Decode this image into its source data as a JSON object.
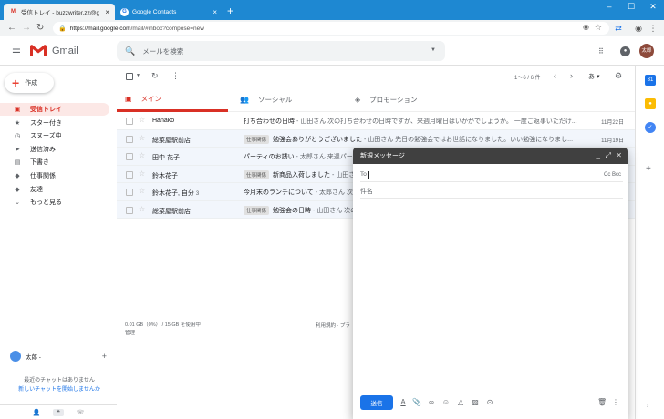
{
  "browser": {
    "tabs": [
      {
        "title": "受信トレイ - buzzwriter.zz@gmail.com",
        "favicon": "M",
        "active": true
      },
      {
        "title": "Google Contacts",
        "favicon": "G",
        "active": false
      }
    ],
    "url_host": "https://mail.google.com",
    "url_path": "/mail/#inbox?compose=new",
    "colors": {
      "tabbar": "#1e88d2"
    }
  },
  "gmail": {
    "logo_text": "Gmail",
    "search_placeholder": "メールを検索",
    "avatar_text": "太郎"
  },
  "sidebar": {
    "compose_label": "作成",
    "items": [
      {
        "label": "受信トレイ",
        "icon": "inbox-icon",
        "glyph": "▣",
        "active": true
      },
      {
        "label": "スター付き",
        "icon": "star-icon",
        "glyph": "★",
        "active": false
      },
      {
        "label": "スヌーズ中",
        "icon": "clock-icon",
        "glyph": "◷",
        "active": false
      },
      {
        "label": "送信済み",
        "icon": "send-icon",
        "glyph": "➤",
        "active": false
      },
      {
        "label": "下書き",
        "icon": "draft-icon",
        "glyph": "▤",
        "active": false
      },
      {
        "label": "仕事関係",
        "icon": "label-icon",
        "glyph": "◆",
        "active": false
      },
      {
        "label": "友達",
        "icon": "label-icon",
        "glyph": "◆",
        "active": false
      },
      {
        "label": "もっと見る",
        "icon": "chevron-down-icon",
        "glyph": "⌄",
        "active": false
      }
    ]
  },
  "hangouts": {
    "user": "太郎 -",
    "no_chats": "最近のチャットはありません",
    "start_chat": "新しいチャットを開始しませんか"
  },
  "toolbar": {
    "count": "1～6 / 6 件",
    "input_tool": "あ"
  },
  "categories": [
    {
      "label": "メイン",
      "icon": "inbox-icon",
      "active": true
    },
    {
      "label": "ソーシャル",
      "icon": "people-icon",
      "active": false
    },
    {
      "label": "プロモーション",
      "icon": "tag-icon",
      "active": false
    }
  ],
  "emails": [
    {
      "sender": "Hanako",
      "count": "",
      "label": "",
      "subject": "打ち合わせの日時",
      "snippet": " - 山田さん 次の打ち合わせの日時ですが、来週月曜日はいかがでしょうか。 一度ご返事いただけ...",
      "date": "11月22日",
      "unread": true
    },
    {
      "sender": "総菜屋駅前店",
      "count": "",
      "label": "仕事関係",
      "subject": "勉強会ありがとうございました",
      "snippet": " - 山田さん 先日の勉強会ではお世話になりました。いい勉強になりまし...",
      "date": "11月19日",
      "unread": false
    },
    {
      "sender": "田中 花子",
      "count": "",
      "label": "",
      "subject": "パーティのお誘い",
      "snippet": " - 太郎さん 来週パーティがあります",
      "date": "",
      "unread": false
    },
    {
      "sender": "鈴木花子",
      "count": "",
      "label": "仕事関係",
      "subject": "新商品入荷しました",
      "snippet": " - 山田さん",
      "date": "",
      "unread": false
    },
    {
      "sender": "鈴木花子, 自分",
      "count": "3",
      "label": "",
      "subject": "今月末のランチについて",
      "snippet": " - 太郎さん 次の",
      "date": "",
      "unread": false
    },
    {
      "sender": "総菜屋駅前店",
      "count": "",
      "label": "仕事関係",
      "subject": "勉強会の日時",
      "snippet": " - 山田さん 次の",
      "date": "",
      "unread": false
    }
  ],
  "footer": {
    "usage": "0.01 GB（0%） / 15 GB を使用中",
    "manage": "管理",
    "terms": "利用規約 · プラ"
  },
  "compose_window": {
    "title": "新規メッセージ",
    "to_label": "To",
    "ccbcc": "Cc Bcc",
    "subject_placeholder": "件名",
    "send_label": "送信"
  }
}
